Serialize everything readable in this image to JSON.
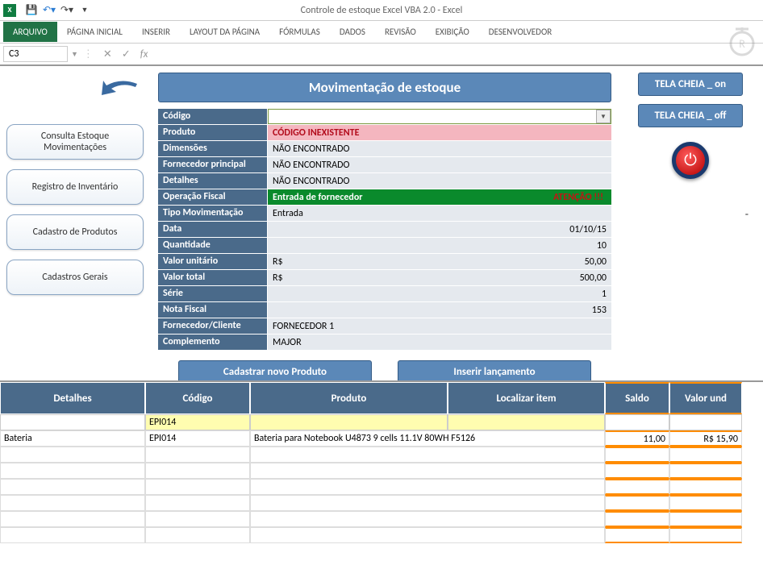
{
  "window": {
    "title": "Controle de estoque Excel VBA 2.0 - Excel"
  },
  "ribbon": {
    "tabs": [
      "ARQUIVO",
      "PÁGINA INICIAL",
      "INSERIR",
      "LAYOUT DA PÁGINA",
      "FÓRMULAS",
      "DADOS",
      "REVISÃO",
      "EXIBIÇÃO",
      "DESENVOLVEDOR"
    ]
  },
  "namebox": "C3",
  "sidebar": {
    "items": [
      "Consulta Estoque Movimentações",
      "Registro de Inventário",
      "Cadastro de Produtos",
      "Cadastros Gerais"
    ]
  },
  "form": {
    "title": "Movimentação de estoque",
    "rows": {
      "codigo": {
        "label": "Código",
        "value": ""
      },
      "produto": {
        "label": "Produto",
        "value": "CÓDIGO INEXISTENTE"
      },
      "dimensoes": {
        "label": "Dimensões",
        "value": "NÃO ENCONTRADO"
      },
      "fornprinc": {
        "label": "Fornecedor principal",
        "value": "NÃO ENCONTRADO"
      },
      "detalhes": {
        "label": "Detalhes",
        "value": "NÃO ENCONTRADO"
      },
      "opfiscal": {
        "label": "Operação Fiscal",
        "value": "Entrada de fornecedor",
        "warn": "ATENÇÃO !!!"
      },
      "tipomov": {
        "label": "Tipo Movimentação",
        "value": "Entrada"
      },
      "data": {
        "label": "Data",
        "value": "01/10/15"
      },
      "qtd": {
        "label": "Quantidade",
        "value": "10"
      },
      "vunit": {
        "label": "Valor unitário",
        "currency": "R$",
        "value": "50,00"
      },
      "vtotal": {
        "label": "Valor total",
        "currency": "R$",
        "value": "500,00"
      },
      "serie": {
        "label": "Série",
        "value": "1"
      },
      "nf": {
        "label": "Nota Fiscal",
        "value": "153"
      },
      "forncli": {
        "label": "Fornecedor/Cliente",
        "value": "FORNECEDOR 1"
      },
      "compl": {
        "label": "Complemento",
        "value": "MAJOR"
      }
    },
    "actions": {
      "cad": "Cadastrar novo Produto",
      "ins": "Inserir lançamento"
    }
  },
  "right": {
    "on": "TELA CHEIA _ on",
    "off": "TELA CHEIA _ off",
    "dash": "-"
  },
  "grid": {
    "headers": {
      "det": "Detalhes",
      "cod": "Código",
      "prod": "Produto",
      "loc": "Localizar item",
      "sal": "Saldo",
      "val": "Valor und"
    },
    "filter": {
      "cod": "EPI014"
    },
    "row": {
      "det": "Bateria",
      "cod": "EPI014",
      "prod": "Bateria para Notebook U4873 9 cells 11.1V 80WH F5126",
      "sal": "11,00",
      "val": "R$ 15,90"
    }
  }
}
